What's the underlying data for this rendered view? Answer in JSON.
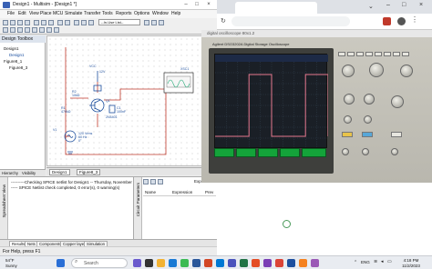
{
  "multisim": {
    "title": "Design1 - Multisim - [Design1 *]",
    "menu": [
      "File",
      "Edit",
      "View",
      "Place",
      "MCU",
      "Simulate",
      "Transfer",
      "Tools",
      "Reports",
      "Options",
      "Window",
      "Help"
    ],
    "in_use_list": "--In-Use List--",
    "design_toolbox": "Design Toolbox",
    "tree": [
      "Design1",
      "Design1",
      "Figure8_1",
      "Figure8_3"
    ],
    "toolbox_tabs": [
      "Hierarchy",
      "Visibility"
    ],
    "workspace_tabs": [
      "Design1",
      "Figure8_3"
    ],
    "schematic_labels": {
      "xsc": "XSC1",
      "vcc": "VCC",
      "vcc_v": "12V",
      "r2": "R2",
      "r2_val": "10kΩ",
      "r1": "R1",
      "r1_val": "470kΩ",
      "q1": "Q1",
      "q1_part": "2N4401",
      "c1": "C1",
      "c1_val": "100nF",
      "v1": "V1",
      "v1_a": "120 Vrms",
      "v1_b": "60 Hz",
      "v1_c": "0°"
    },
    "spreadsheet_lines": [
      "----------Checking SPICE netlist for Design1 -- Thursday, November 2,",
      "----- SPICE Netlist check completed, 0 error(s), 0 warning(s)"
    ],
    "spreadsheet_label": "Spreadsheet View",
    "circuit_params_label": "Circuit Parameters",
    "params_headers": [
      "Name",
      "Expression",
      "Prev"
    ],
    "export_label": "Export",
    "bottom_tabs": [
      "Results",
      "Nets",
      "Components",
      "Copper layers",
      "Simulation"
    ],
    "status": "For Help, press F1"
  },
  "browser": {
    "image_title": "digital oscilloscope 80x1.2",
    "scope_brand": "Agilent DSO3202A  Digital Storage Oscilloscope"
  },
  "taskbar": {
    "weather_temp": "54°F",
    "weather_desc": "Sunny",
    "search": "Search",
    "lang": "ENG",
    "time": "4:18 PM",
    "date": "11/2/2023"
  },
  "chart_data": {
    "type": "line",
    "description_source": "oscilloscope trace",
    "x": [
      0,
      1,
      2,
      3,
      4,
      5,
      6,
      7,
      8,
      9,
      10
    ],
    "values": [
      0,
      0,
      0,
      1,
      1,
      0,
      0,
      0,
      1,
      1,
      0
    ]
  }
}
